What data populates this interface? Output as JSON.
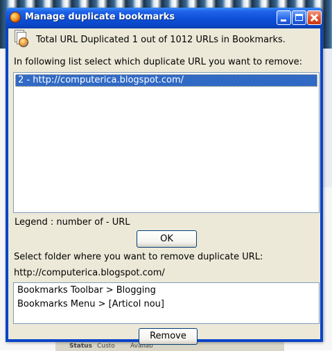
{
  "window": {
    "title": "Manage duplicate bookmarks",
    "icon": "firefox-icon"
  },
  "summary_text": "Total URL Duplicated 1 out of 1012 URLs in Bookmarks.",
  "instruction_text": "In following list select which duplicate URL you want to remove:",
  "duplicate_list": {
    "items": [
      {
        "label": "2  -  http://computerica.blogspot.com/",
        "selected": true
      }
    ]
  },
  "legend_text": "Legend : number of - URL",
  "ok_button_label": "OK",
  "folder_prompt_text": "Select folder where you want to remove duplicate URL:",
  "selected_url": "http://computerica.blogspot.com/",
  "folder_list": {
    "items": [
      {
        "label": "Bookmarks Toolbar > Blogging"
      },
      {
        "label": "Bookmarks Menu > [Articol nou]"
      }
    ]
  },
  "remove_button_label": "Remove",
  "background_window": {
    "status_label": "Status",
    "option_1": "Custo",
    "option_2": "Availab"
  },
  "colors": {
    "titlebar": "#0a46c6",
    "client_bg": "#ece9d8",
    "selection": "#316ac5"
  }
}
